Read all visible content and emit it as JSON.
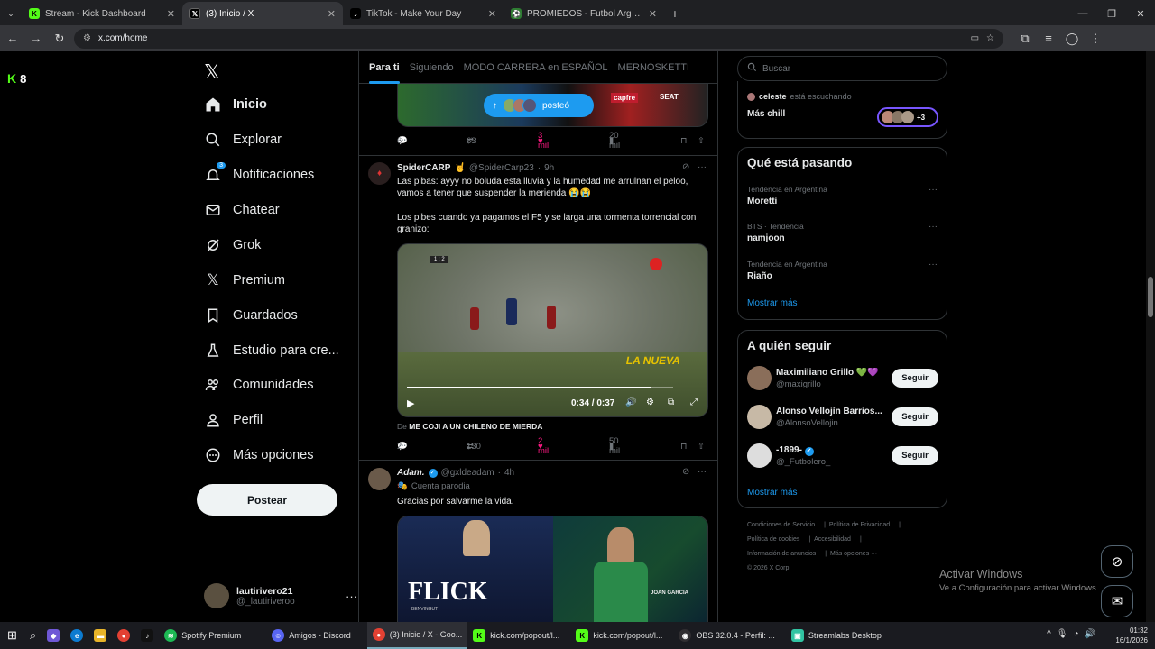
{
  "browser": {
    "tabs": [
      {
        "title": "Stream - Kick Dashboard",
        "icon": "kick-icon"
      },
      {
        "title": "(3) Inicio / X",
        "icon": "x-icon",
        "active": true
      },
      {
        "title": "TikTok - Make Your Day",
        "icon": "tiktok-icon"
      },
      {
        "title": "PROMIEDOS - Futbol Argentino",
        "icon": "promiedos-icon"
      }
    ],
    "url": "x.com/home"
  },
  "kick_overlay": {
    "count": "8"
  },
  "sidebar": {
    "items": [
      {
        "label": "Inicio",
        "icon": "home-icon"
      },
      {
        "label": "Explorar",
        "icon": "search-icon"
      },
      {
        "label": "Notificaciones",
        "icon": "bell-icon",
        "badge": "3"
      },
      {
        "label": "Chatear",
        "icon": "mail-icon"
      },
      {
        "label": "Grok",
        "icon": "grok-icon"
      },
      {
        "label": "Premium",
        "icon": "x-icon"
      },
      {
        "label": "Guardados",
        "icon": "bookmark-icon"
      },
      {
        "label": "Estudio para cre...",
        "icon": "flask-icon"
      },
      {
        "label": "Comunidades",
        "icon": "communities-icon"
      },
      {
        "label": "Perfil",
        "icon": "person-icon"
      },
      {
        "label": "Más opciones",
        "icon": "more-icon"
      }
    ],
    "post_label": "Postear",
    "profile": {
      "name": "lautirivero21",
      "handle": "@_lautiriveroo"
    }
  },
  "timeline": {
    "tabs": [
      "Para ti",
      "Siguiendo",
      "MODO CARRERA en ESPAÑOL",
      "MERNOSKETTI"
    ],
    "new_posts_label": "posteó",
    "tweet0": {
      "replies": "6",
      "reposts": "63",
      "likes": "3 mil",
      "views": "20 mil"
    },
    "tweet1": {
      "name": "SpiderCARP",
      "handle": "@SpiderCarp23",
      "time": "9h",
      "text1": "Las pibas: ayyy no boluda esta lluvia y la humedad me arrulnan el peloo, vamos a tener que suspender la merienda 😭😭",
      "text2": "Los pibes cuando ya pagamos el F5 y se larga una tormenta torrencial con granizo:",
      "video_time": "0:34 / 0:37",
      "video_caption": "LA NUEVA",
      "scoreboard": "1 : 2",
      "from_prefix": "De",
      "from_user": "ME COJI A UN CHILENO DE MIERDA",
      "replies": "2",
      "reposts": "130",
      "likes": "2 mil",
      "views": "50 mil"
    },
    "tweet2": {
      "name": "Adam.",
      "handle": "@gxldeadam",
      "time": "4h",
      "parody": "Cuenta parodia",
      "text": "Gracias por salvarme la vida.",
      "img_left": "FLICK",
      "img_left_sub": "BENVINGUT",
      "img_right": "JOAN GARCIA"
    }
  },
  "right": {
    "search_placeholder": "Buscar",
    "listening": {
      "name": "celeste",
      "status": "está escuchando",
      "space": "Más chill",
      "extra": "+3"
    },
    "trends_title": "Qué está pasando",
    "trends": [
      {
        "context": "Tendencia en Argentina",
        "name": "Moretti"
      },
      {
        "context": "BTS · Tendencia",
        "name": "namjoon"
      },
      {
        "context": "Tendencia en Argentina",
        "name": "Riaño"
      }
    ],
    "show_more": "Mostrar más",
    "follow_title": "A quién seguir",
    "follow": [
      {
        "name": "Maximiliano Grillo 💚💜",
        "handle": "@maxigrillo",
        "button": "Seguir"
      },
      {
        "name": "Alonso Vellojín Barrios...",
        "handle": "@AlonsoVellojin",
        "button": "Seguir"
      },
      {
        "name": "-1899-",
        "handle": "@_Futbolero_",
        "button": "Seguir"
      }
    ],
    "footer": [
      "Condiciones de Servicio",
      "Política de Privacidad",
      "Política de cookies",
      "Accesibilidad",
      "Información de anuncios",
      "Más opciones ···",
      "© 2026 X Corp."
    ]
  },
  "activate_windows": {
    "title": "Activar Windows",
    "subtitle": "Ve a Configuración para activar Windows."
  },
  "taskbar": {
    "items": [
      {
        "label": "Spotify Premium",
        "icon": "spotify-icon"
      },
      {
        "label": "Amigos - Discord",
        "icon": "discord-icon"
      },
      {
        "label": "(3) Inicio / X - Goo...",
        "icon": "chrome-icon",
        "active": true
      },
      {
        "label": "kick.com/popout/l...",
        "icon": "kick-icon"
      },
      {
        "label": "kick.com/popout/l...",
        "icon": "kick-icon"
      },
      {
        "label": "OBS 32.0.4 - Perfil: ...",
        "icon": "obs-icon"
      },
      {
        "label": "Streamlabs Desktop",
        "icon": "streamlabs-icon"
      }
    ],
    "time": "01:32",
    "date": "16/1/2026"
  }
}
